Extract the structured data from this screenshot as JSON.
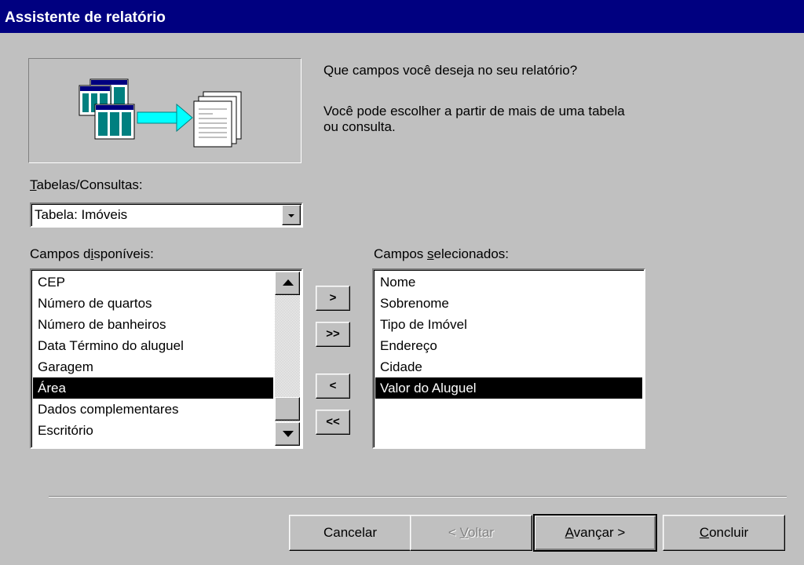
{
  "window": {
    "title": "Assistente de relatório"
  },
  "prompt": {
    "question": "Que campos você deseja no seu relatório?",
    "info_line1": "Você pode escolher a partir de mais de uma tabela",
    "info_line2": "ou consulta."
  },
  "tables": {
    "label_underlined": "T",
    "label_rest": "abelas/Consultas:",
    "selected_value": "Tabela: Imóveis"
  },
  "available_fields": {
    "label_before": "Campos d",
    "label_underlined": "i",
    "label_after": "sponíveis:",
    "items": [
      "CEP",
      "Número de quartos",
      "Número de banheiros",
      "Data Término do aluguel",
      "Garagem",
      "Área",
      "Dados complementares",
      "Escritório"
    ],
    "selected_index": 5
  },
  "selected_fields": {
    "label_before": "Campos ",
    "label_underlined": "s",
    "label_after": "elecionados:",
    "items": [
      "Nome",
      "Sobrenome",
      "Tipo de Imóvel",
      "Endereço",
      "Cidade",
      "Valor do Aluguel"
    ],
    "selected_index": 5
  },
  "transfer_buttons": {
    "add_one": ">",
    "add_all": ">>",
    "remove_one": "<",
    "remove_all": "<<"
  },
  "footer": {
    "cancel": "Cancelar",
    "back_prefix": "< ",
    "back_underlined": "V",
    "back_rest": "oltar",
    "next_underlined": "A",
    "next_rest": "vançar >",
    "finish_underlined": "C",
    "finish_rest": "oncluir"
  },
  "colors": {
    "titlebar": "#000080",
    "face": "#c0c0c0",
    "selection": "#000000",
    "arrow_accent": "#00ffff"
  },
  "icons": [
    "tables-icon",
    "arrow-right-icon",
    "report-icon",
    "scroll-up-icon",
    "scroll-down-icon",
    "dropdown-arrow-icon"
  ]
}
